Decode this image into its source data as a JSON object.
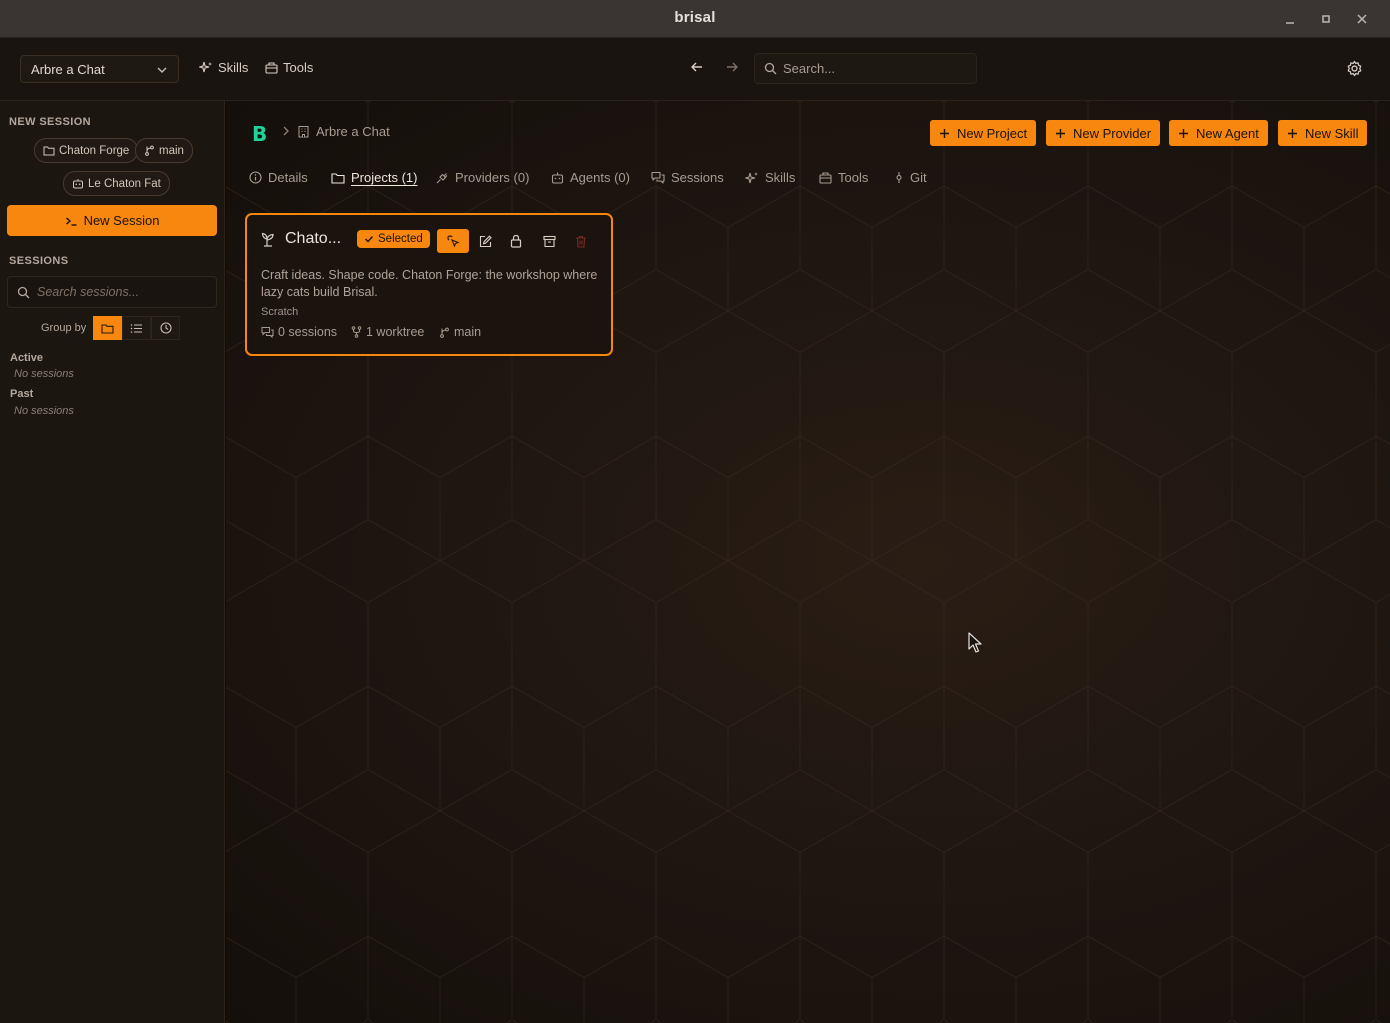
{
  "window": {
    "title": "brisal"
  },
  "topbar": {
    "project_selector": "Arbre a Chat",
    "links": [
      "Skills",
      "Tools"
    ],
    "search_placeholder": "Search..."
  },
  "sidebar": {
    "new_session_label": "NEW SESSION",
    "chips": {
      "project": "Chaton Forge",
      "branch": "main",
      "agent": "Le Chaton Fat"
    },
    "new_session_button": "New Session",
    "sessions_label": "SESSIONS",
    "search_placeholder": "Search sessions...",
    "group_by_label": "Group by",
    "groups": [
      {
        "title": "Active",
        "empty": "No sessions"
      },
      {
        "title": "Past",
        "empty": "No sessions"
      }
    ]
  },
  "main": {
    "logo": "B",
    "breadcrumb": "Arbre a Chat",
    "header_buttons": [
      "New Project",
      "New Provider",
      "New Agent",
      "New Skill"
    ],
    "tabs": [
      "Details",
      "Projects (1)",
      "Providers (0)",
      "Agents (0)",
      "Sessions",
      "Skills",
      "Tools",
      "Git"
    ],
    "active_tab": "Projects (1)",
    "project_card": {
      "title": "Chato...",
      "badge": "Selected",
      "description": "Craft ideas. Shape code. Chaton Forge: the workshop where lazy cats build Brisal.",
      "tag": "Scratch",
      "sessions": "0 sessions",
      "worktrees": "1 worktree",
      "branch": "main"
    }
  },
  "colors": {
    "accent": "#f7870f",
    "logo": "#1fd39a",
    "background": "#1d1510"
  }
}
